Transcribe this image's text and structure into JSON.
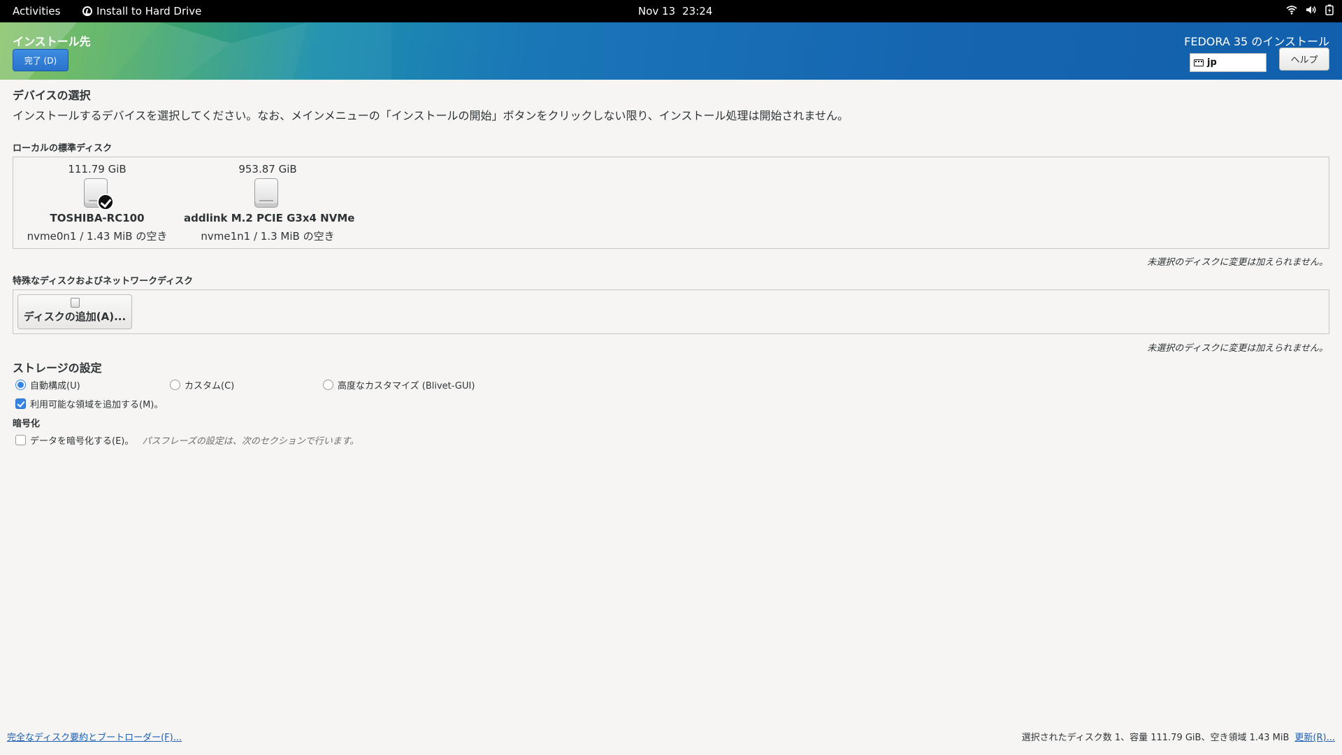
{
  "topbar": {
    "activities": "Activities",
    "app_name": "Install to Hard Drive",
    "date": "Nov 13",
    "time": "23:24"
  },
  "header": {
    "spoke_title": "インストール先",
    "done_button": "完了 (D)",
    "distro_title": "FEDORA 35 のインストール",
    "keyboard_layout": "jp",
    "help_button": "ヘルプ"
  },
  "device_selection": {
    "title": "デバイスの選択",
    "description": "インストールするデバイスを選択してください。なお、メインメニューの「インストールの開始」ボタンをクリックしない限り、インストール処理は開始されません。"
  },
  "local_disks": {
    "label": "ローカルの標準ディスク",
    "disks": [
      {
        "size": "111.79 GiB",
        "name": "TOSHIBA-RC100",
        "info": "nvme0n1  /  1.43 MiB の空き",
        "selected": true
      },
      {
        "size": "953.87 GiB",
        "name": "addlink M.2 PCIE G3x4 NVMe",
        "info": "nvme1n1  /  1.3 MiB の空き",
        "selected": false
      }
    ],
    "note": "未選択のディスクに変更は加えられません。"
  },
  "special_disks": {
    "label": "特殊なディスクおよびネットワークディスク",
    "add_button": "ディスクの追加(A)...",
    "note": "未選択のディスクに変更は加えられません。"
  },
  "storage_config": {
    "title": "ストレージの設定",
    "options": [
      {
        "label": "自動構成(U)",
        "selected": true
      },
      {
        "label": "カスタム(C)",
        "selected": false
      },
      {
        "label": "高度なカスタマイズ (Blivet-GUI)",
        "selected": false
      }
    ],
    "free_space_checkbox": {
      "label": "利用可能な領域を追加する(M)。",
      "checked": true
    }
  },
  "encryption": {
    "title": "暗号化",
    "checkbox": {
      "label": "データを暗号化する(E)。",
      "checked": false
    },
    "hint": "パスフレーズの設定は、次のセクションで行います。"
  },
  "footer": {
    "summary_link": "完全なディスク要約とブートローダー(F)...",
    "summary": "選択されたディスク数 1、容量 111.79 GiB、空き領域 1.43 MiB",
    "refresh_link": "更新(R)..."
  },
  "colors": {
    "accent": "#3584e4",
    "header_blue": "#1565b0",
    "header_green": "#6fb74a",
    "link": "#1a5fb4"
  }
}
